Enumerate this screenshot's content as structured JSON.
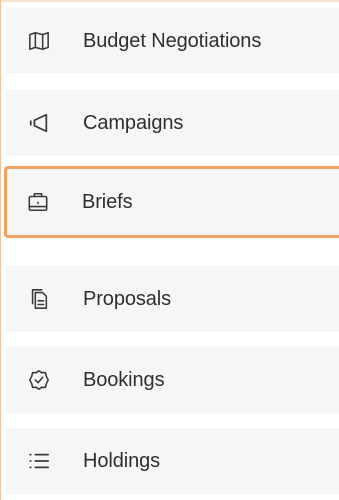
{
  "sidebar": {
    "items": [
      {
        "label": "Budget Negotiations",
        "icon": "map-icon",
        "active": false
      },
      {
        "label": "Campaigns",
        "icon": "megaphone-icon",
        "active": false
      },
      {
        "label": "Briefs",
        "icon": "briefcase-icon",
        "active": true
      },
      {
        "label": "Proposals",
        "icon": "documents-icon",
        "active": false
      },
      {
        "label": "Bookings",
        "icon": "badge-check-icon",
        "active": false
      },
      {
        "label": "Holdings",
        "icon": "list-icon",
        "active": false
      }
    ],
    "colors": {
      "active_border": "#f2a161",
      "item_background": "#f6f6f6",
      "text": "#2f2f33",
      "icon": "#3a3a3e"
    }
  }
}
